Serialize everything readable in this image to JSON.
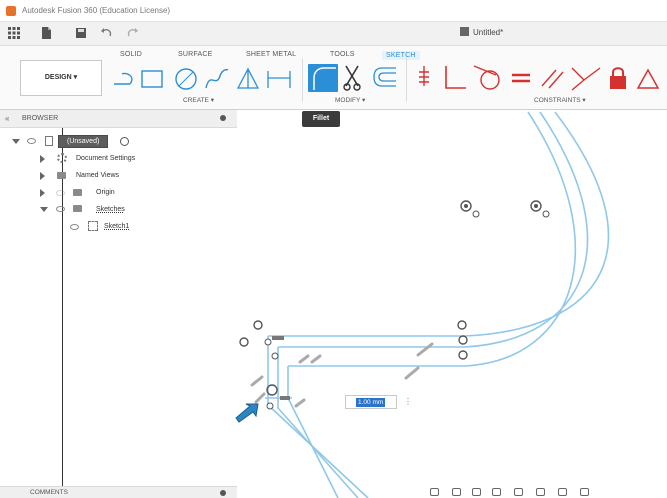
{
  "window": {
    "title": "Autodesk Fusion 360 (Education License)"
  },
  "document": {
    "tab_label": "Untitled*"
  },
  "ribbon": {
    "tabs": [
      {
        "label": "SOLID",
        "active": false
      },
      {
        "label": "SURFACE",
        "active": false
      },
      {
        "label": "SHEET METAL",
        "active": false
      },
      {
        "label": "TOOLS",
        "active": false
      },
      {
        "label": "SKETCH",
        "active": true
      }
    ],
    "workspace_button": "DESIGN ▾",
    "groups": {
      "create": "CREATE ▾",
      "modify": "MODIFY ▾",
      "constraints": "CONSTRAINTS ▾"
    },
    "tooltip": "Fillet",
    "accent_color": "#2c8fd0"
  },
  "browser": {
    "header": "BROWSER",
    "items": [
      {
        "label": "(Unsaved)"
      },
      {
        "label": "Document Settings"
      },
      {
        "label": "Named Views"
      },
      {
        "label": "Origin"
      },
      {
        "label": "Sketches"
      },
      {
        "label": "Sketch1"
      }
    ]
  },
  "dimension": {
    "value": "1.00 mm"
  },
  "comments": {
    "label": "COMMENTS"
  },
  "icons": {
    "grid": "grid-icon",
    "file": "file-icon",
    "save": "save-icon",
    "undo": "undo-icon",
    "redo": "redo-icon",
    "line": "line-icon",
    "rectangle": "rectangle-icon",
    "circle": "circle-icon",
    "spline": "spline-icon",
    "triangle": "triangle-icon",
    "dimension": "dimension-icon",
    "fillet": "fillet-icon",
    "trim": "scissors-icon",
    "offset": "offset-icon",
    "fix": "fix-constraint-icon",
    "coincident": "coincident-icon",
    "tangent": "tangent-icon",
    "equal": "equal-icon",
    "parallel": "parallel-icon",
    "perpendicular": "perpendicular-icon",
    "lock": "lock-icon",
    "sketch_triangle": "triangle-constraint-icon"
  }
}
